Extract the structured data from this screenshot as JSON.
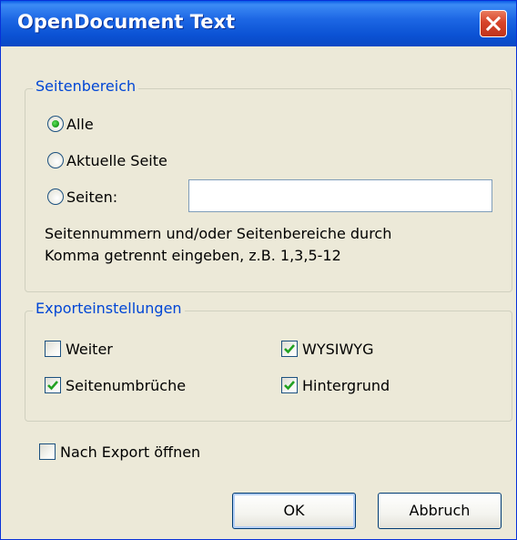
{
  "window": {
    "title": "OpenDocument Text"
  },
  "page_range": {
    "legend": "Seitenbereich",
    "options": [
      {
        "label": "Alle",
        "selected": true
      },
      {
        "label": "Aktuelle Seite",
        "selected": false
      },
      {
        "label": "Seiten:",
        "selected": false
      }
    ],
    "pages_input_value": "",
    "hint_line1": "Seitennummern und/oder Seitenbereiche durch",
    "hint_line2": "Komma getrennt eingeben, z.B. 1,3,5-12"
  },
  "export_settings": {
    "legend": "Exporteinstellungen",
    "checkboxes": [
      {
        "label": "Weiter",
        "checked": false
      },
      {
        "label": "WYSIWYG",
        "checked": true
      },
      {
        "label": "Seitenumbrüche",
        "checked": true
      },
      {
        "label": "Hintergrund",
        "checked": true
      }
    ]
  },
  "open_after_export": {
    "label": "Nach Export öffnen",
    "checked": false
  },
  "buttons": {
    "ok": "OK",
    "cancel": "Abbruch"
  },
  "colors": {
    "title_bar": "#0b52d4",
    "accent_text": "#0046d5",
    "check_mark": "#21a121"
  }
}
